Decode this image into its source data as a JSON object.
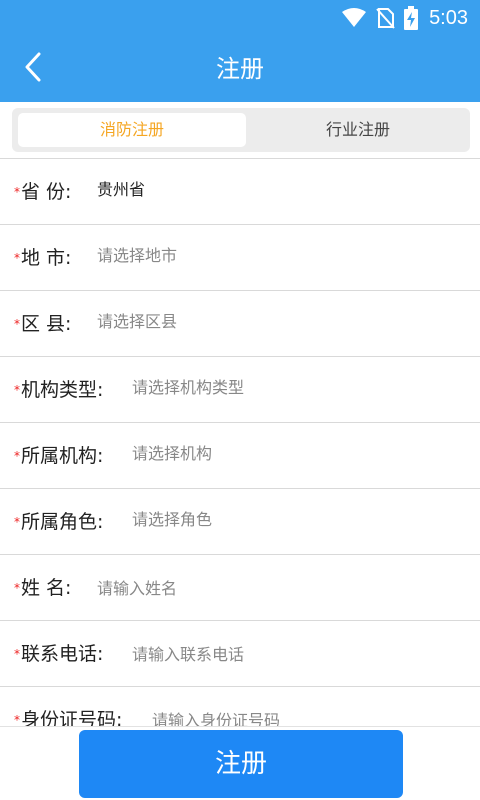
{
  "status_bar": {
    "time": "5:03",
    "icons": [
      "wifi-icon",
      "no-sim-icon",
      "battery-charging-icon"
    ]
  },
  "header": {
    "title": "注册",
    "back_icon": "chevron-left-icon"
  },
  "tabs": [
    {
      "label": "消防注册",
      "active": true
    },
    {
      "label": "行业注册",
      "active": false
    }
  ],
  "form": {
    "fields": [
      {
        "required": "*",
        "label": "省 份:",
        "value": "贵州省",
        "placeholder": ""
      },
      {
        "required": "*",
        "label": "地 市:",
        "value": "",
        "placeholder": "请选择地市"
      },
      {
        "required": "*",
        "label": "区 县:",
        "value": "",
        "placeholder": "请选择区县"
      },
      {
        "required": "*",
        "label": "机构类型:",
        "value": "",
        "placeholder": "请选择机构类型"
      },
      {
        "required": "*",
        "label": "所属机构:",
        "value": "",
        "placeholder": "请选择机构"
      },
      {
        "required": "*",
        "label": "所属角色:",
        "value": "",
        "placeholder": "请选择角色"
      },
      {
        "required": "*",
        "label": "姓 名:",
        "value": "",
        "placeholder": "请输入姓名"
      },
      {
        "required": "*",
        "label": "联系电话:",
        "value": "",
        "placeholder": "请输入联系电话"
      },
      {
        "required": "*",
        "label": "身份证号码:",
        "value": "",
        "placeholder": "请输入身份证号码"
      }
    ]
  },
  "submit": {
    "label": "注册"
  },
  "colors": {
    "header": "#3aa0ee",
    "tab_active_text": "#f5a623",
    "required": "#ee2222",
    "button": "#1e88f5"
  }
}
